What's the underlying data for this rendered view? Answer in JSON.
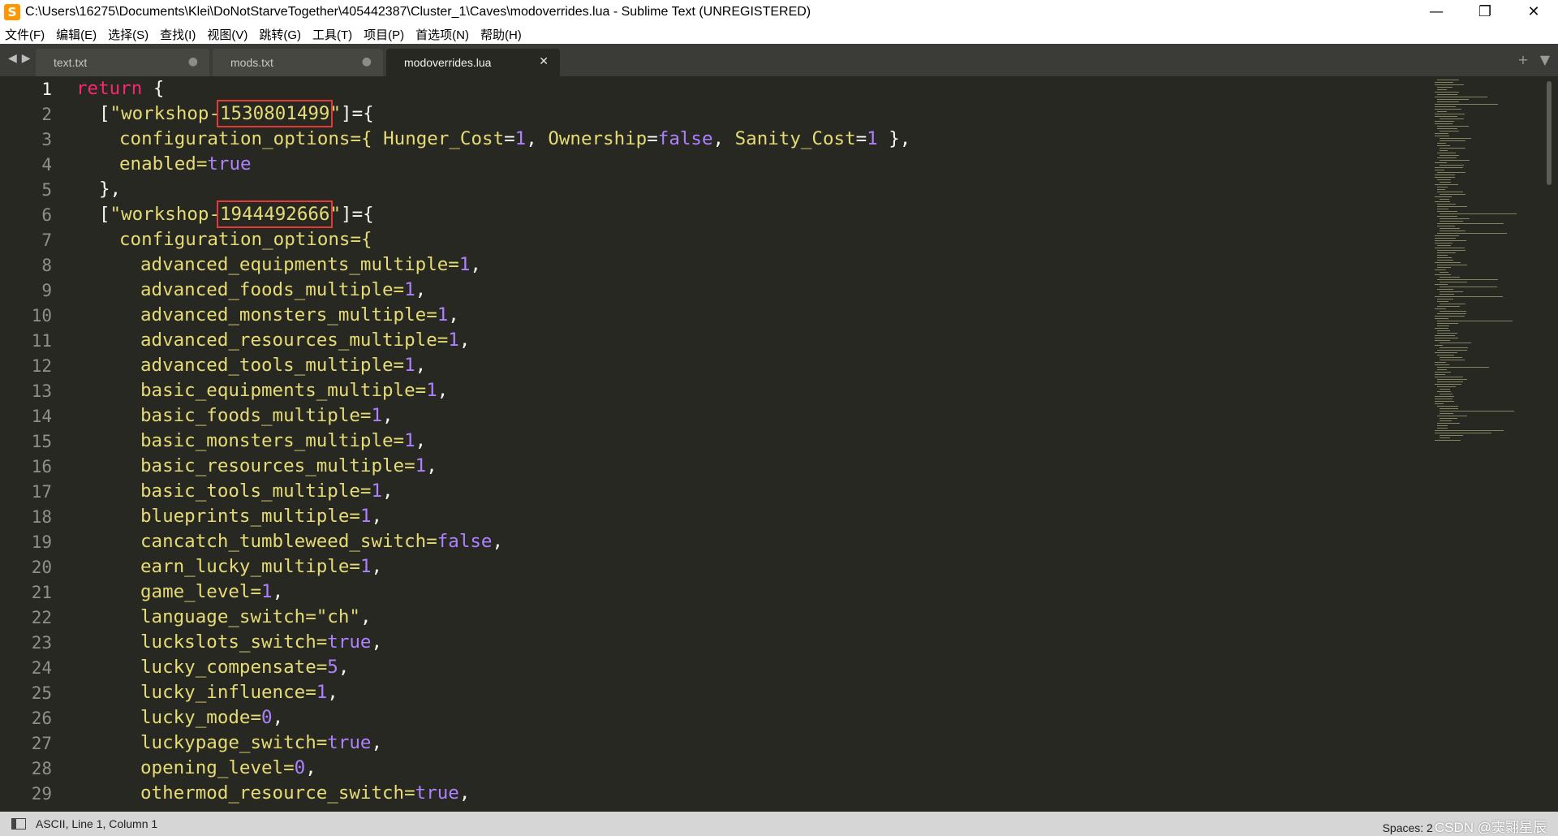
{
  "window": {
    "title": "C:\\Users\\16275\\Documents\\Klei\\DoNotStarveTogether\\405442387\\Cluster_1\\Caves\\modoverrides.lua - Sublime Text (UNREGISTERED)",
    "app_icon": "S",
    "minimize": "—",
    "maximize": "❐",
    "close": "✕"
  },
  "menu": [
    "文件(F)",
    "编辑(E)",
    "选择(S)",
    "查找(I)",
    "视图(V)",
    "跳转(G)",
    "工具(T)",
    "项目(P)",
    "首选项(N)",
    "帮助(H)"
  ],
  "tabs": [
    {
      "label": "text.txt",
      "state": "●"
    },
    {
      "label": "mods.txt",
      "state": "●"
    },
    {
      "label": "modoverrides.lua",
      "state": "✕"
    }
  ],
  "tab_tools": {
    "add": "+",
    "dropdown": "▼"
  },
  "nav": {
    "back": "◀",
    "forward": "▶"
  },
  "gutter": {
    "lines": [
      "1",
      "2",
      "3",
      "4",
      "5",
      "6",
      "7",
      "8",
      "9",
      "10",
      "11",
      "12",
      "13",
      "14",
      "15",
      "16",
      "17",
      "18",
      "19",
      "20",
      "21",
      "22",
      "23",
      "24",
      "25",
      "26",
      "27",
      "28",
      "29"
    ]
  },
  "code": {
    "l1": {
      "kw": "return",
      "rest": " {"
    },
    "l2": {
      "open": "[",
      "s1": "\"workshop-",
      "id": "1530801499",
      "s2": "\"",
      "close": "]={"
    },
    "l3": {
      "t1": "configuration_options={ ",
      "k1": "Hunger_Cost",
      "t2": "=",
      "v1": "1",
      "t3": ", ",
      "k2": "Ownership",
      "t4": "=",
      "v2": "false",
      "t5": ", ",
      "k3": "Sanity_Cost",
      "t6": "=",
      "v3": "1",
      "t7": " },"
    },
    "l4": {
      "t1": "enabled=",
      "v1": "true"
    },
    "l5": {
      "t1": "},"
    },
    "l6": {
      "open": "[",
      "s1": "\"workshop-",
      "id": "1944492666",
      "s2": "\"",
      "close": "]={"
    },
    "l7": {
      "t1": "configuration_options={"
    },
    "l8": {
      "t1": "advanced_equipments_multiple=",
      "v1": "1",
      "t2": ","
    },
    "l9": {
      "t1": "advanced_foods_multiple=",
      "v1": "1",
      "t2": ","
    },
    "l10": {
      "t1": "advanced_monsters_multiple=",
      "v1": "1",
      "t2": ","
    },
    "l11": {
      "t1": "advanced_resources_multiple=",
      "v1": "1",
      "t2": ","
    },
    "l12": {
      "t1": "advanced_tools_multiple=",
      "v1": "1",
      "t2": ","
    },
    "l13": {
      "t1": "basic_equipments_multiple=",
      "v1": "1",
      "t2": ","
    },
    "l14": {
      "t1": "basic_foods_multiple=",
      "v1": "1",
      "t2": ","
    },
    "l15": {
      "t1": "basic_monsters_multiple=",
      "v1": "1",
      "t2": ","
    },
    "l16": {
      "t1": "basic_resources_multiple=",
      "v1": "1",
      "t2": ","
    },
    "l17": {
      "t1": "basic_tools_multiple=",
      "v1": "1",
      "t2": ","
    },
    "l18": {
      "t1": "blueprints_multiple=",
      "v1": "1",
      "t2": ","
    },
    "l19": {
      "t1": "cancatch_tumbleweed_switch=",
      "v1": "false",
      "t2": ","
    },
    "l20": {
      "t1": "earn_lucky_multiple=",
      "v1": "1",
      "t2": ","
    },
    "l21": {
      "t1": "game_level=",
      "v1": "1",
      "t2": ","
    },
    "l22": {
      "t1": "language_switch=",
      "s1": "\"ch\"",
      "t2": ","
    },
    "l23": {
      "t1": "luckslots_switch=",
      "v1": "true",
      "t2": ","
    },
    "l24": {
      "t1": "lucky_compensate=",
      "v1": "5",
      "t2": ","
    },
    "l25": {
      "t1": "lucky_influence=",
      "v1": "1",
      "t2": ","
    },
    "l26": {
      "t1": "lucky_mode=",
      "v1": "0",
      "t2": ","
    },
    "l27": {
      "t1": "luckypage_switch=",
      "v1": "true",
      "t2": ","
    },
    "l28": {
      "t1": "opening_level=",
      "v1": "0",
      "t2": ","
    },
    "l29": {
      "t1": "othermod_resource_switch=",
      "v1": "true",
      "t2": ","
    }
  },
  "status": {
    "left": "ASCII, Line 1, Column 1",
    "right": "Spaces: 2",
    "watermark": "CSDN @霙翾星辰"
  },
  "colors": {
    "background": "#272822",
    "keyword": "#f92672",
    "string": "#e6db74",
    "constant": "#ae81ff",
    "highlight_box": "#e53935"
  }
}
